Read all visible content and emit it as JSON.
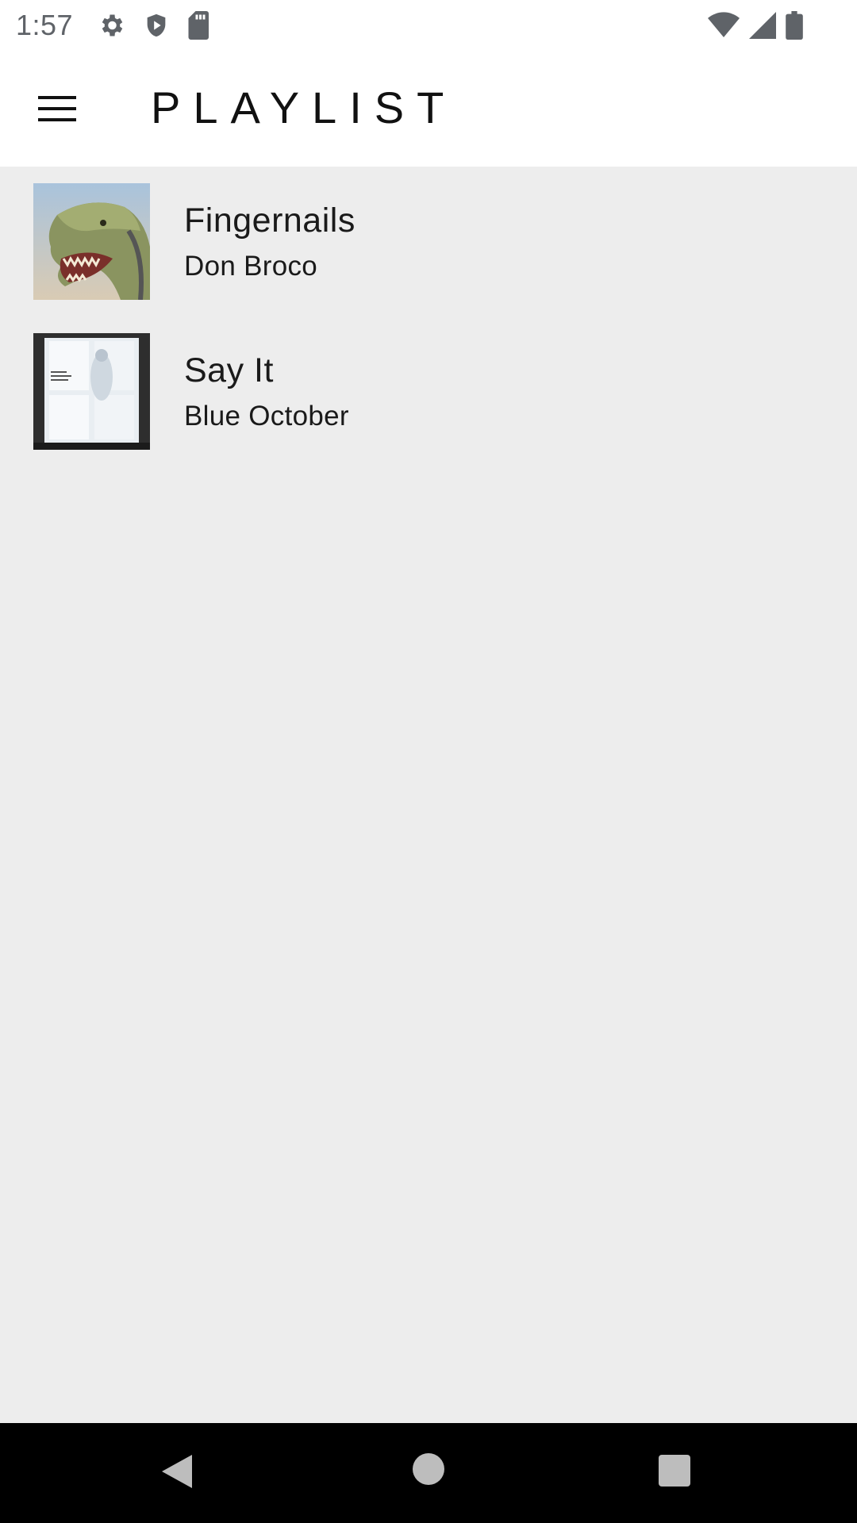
{
  "status_bar": {
    "time": "1:57",
    "icons_left": [
      "gear-icon",
      "shield-icon",
      "sd-card-icon"
    ],
    "icons_right": [
      "wifi-icon",
      "cell-signal-icon",
      "battery-icon"
    ]
  },
  "app_bar": {
    "title": "PLAYLIST",
    "menu_icon": "hamburger-menu-icon"
  },
  "tracks": [
    {
      "title": "Fingernails",
      "artist": "Don Broco"
    },
    {
      "title": "Say It",
      "artist": "Blue October"
    }
  ],
  "nav_bar": {
    "buttons": [
      "back-icon",
      "home-icon",
      "recents-icon"
    ]
  },
  "colors": {
    "background": "#ededed",
    "app_bar": "#ffffff",
    "nav_bar": "#000000",
    "text": "#1a1a1a"
  }
}
